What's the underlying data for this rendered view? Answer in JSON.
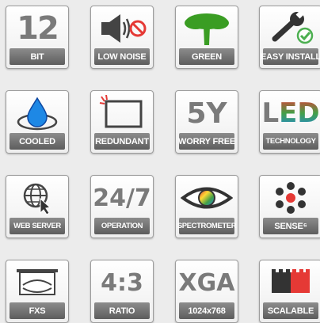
{
  "tiles": [
    {
      "id": "12-bit",
      "label": "BIT",
      "icon_text": "12",
      "icon": "12-bit-icon"
    },
    {
      "id": "low-noise",
      "label": "LOW NOISE",
      "icon": "speaker-muted-icon",
      "accent": "#e53935"
    },
    {
      "id": "green",
      "label": "GREEN",
      "icon": "tree-icon",
      "accent": "#3a9d23"
    },
    {
      "id": "easy-install",
      "label": "EASY INSTALL",
      "icon": "wrench-check-icon",
      "accent": "#4caf50"
    },
    {
      "id": "cooled",
      "label": "COOLED",
      "icon": "water-drop-icon",
      "accent": "#1e88e5"
    },
    {
      "id": "redundant",
      "label": "REDUNDANT",
      "icon": "redundant-screen-icon",
      "accent": "#e53935"
    },
    {
      "id": "worry-free",
      "label": "WORRY FREE",
      "icon_text": "5Y",
      "icon": "five-year-icon"
    },
    {
      "id": "led-technology",
      "label": "TECHNOLOGY",
      "icon_text": "LED",
      "icon": "led-icon",
      "letter_colors": [
        "#e53935",
        "#43a047",
        "#1e88e5"
      ]
    },
    {
      "id": "web-server",
      "label": "WEB SERVER",
      "icon": "globe-cursor-icon"
    },
    {
      "id": "operation",
      "label": "OPERATION",
      "icon_text": "24/7",
      "icon": "24-7-icon"
    },
    {
      "id": "spectrometer",
      "label": "SPECTROMETER",
      "icon": "eye-spectrum-icon"
    },
    {
      "id": "sense",
      "label": "SENSE⁶",
      "icon": "sensor-cluster-icon",
      "accent": "#e53935"
    },
    {
      "id": "fxs",
      "label": "FXS",
      "icon": "fxs-screen-icon"
    },
    {
      "id": "ratio",
      "label": "RATIO",
      "icon_text": "4:3",
      "icon": "aspect-ratio-icon"
    },
    {
      "id": "xga",
      "label": "1024x768",
      "icon_text": "XGA",
      "icon": "xga-icon"
    },
    {
      "id": "scalable",
      "label": "SCALABLE",
      "icon": "scalable-blocks-icon",
      "accent": "#e53935"
    }
  ]
}
